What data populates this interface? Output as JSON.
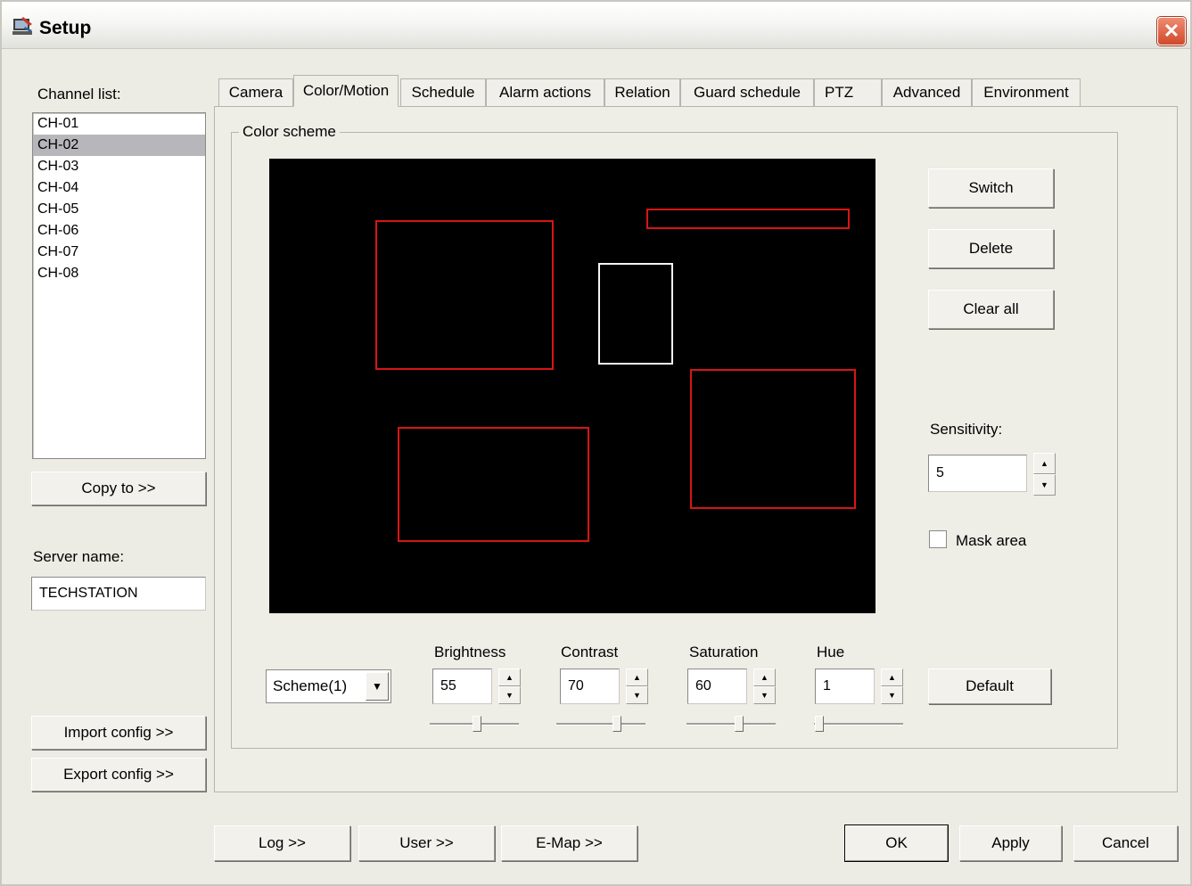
{
  "window": {
    "title": "Setup"
  },
  "sidebar": {
    "channel_list_label": "Channel list:",
    "channels": [
      {
        "label": "CH-01",
        "selected": false
      },
      {
        "label": "CH-02",
        "selected": true
      },
      {
        "label": "CH-03",
        "selected": false
      },
      {
        "label": "CH-04",
        "selected": false
      },
      {
        "label": "CH-05",
        "selected": false
      },
      {
        "label": "CH-06",
        "selected": false
      },
      {
        "label": "CH-07",
        "selected": false
      },
      {
        "label": "CH-08",
        "selected": false
      }
    ],
    "copy_to": "Copy to >>",
    "server_name_label": "Server name:",
    "server_name_value": "TECHSTATION",
    "import_config": "Import config >>",
    "export_config": "Export config >>"
  },
  "tabs": [
    {
      "label": "Camera",
      "active": false
    },
    {
      "label": "Color/Motion",
      "active": true
    },
    {
      "label": "Schedule",
      "active": false
    },
    {
      "label": "Alarm actions",
      "active": false
    },
    {
      "label": "Relation",
      "active": false
    },
    {
      "label": "Guard schedule",
      "active": false
    },
    {
      "label": "PTZ",
      "active": false
    },
    {
      "label": "Advanced",
      "active": false
    },
    {
      "label": "Environment",
      "active": false
    }
  ],
  "color_scheme": {
    "group_title": "Color scheme",
    "switch": "Switch",
    "delete": "Delete",
    "clear_all": "Clear all",
    "sensitivity_label": "Sensitivity:",
    "sensitivity_value": "5",
    "mask_area_label": "Mask area",
    "mask_area_checked": false,
    "scheme_select": "Scheme(1)",
    "brightness_label": "Brightness",
    "brightness_value": "55",
    "contrast_label": "Contrast",
    "contrast_value": "70",
    "saturation_label": "Saturation",
    "saturation_value": "60",
    "hue_label": "Hue",
    "hue_value": "1",
    "default": "Default",
    "zone_colors": {
      "normal": "#d81515",
      "selected": "#f4f4f4"
    }
  },
  "footer": {
    "log": "Log >>",
    "user": "User >>",
    "emap": "E-Map >>",
    "ok": "OK",
    "apply": "Apply",
    "cancel": "Cancel"
  }
}
